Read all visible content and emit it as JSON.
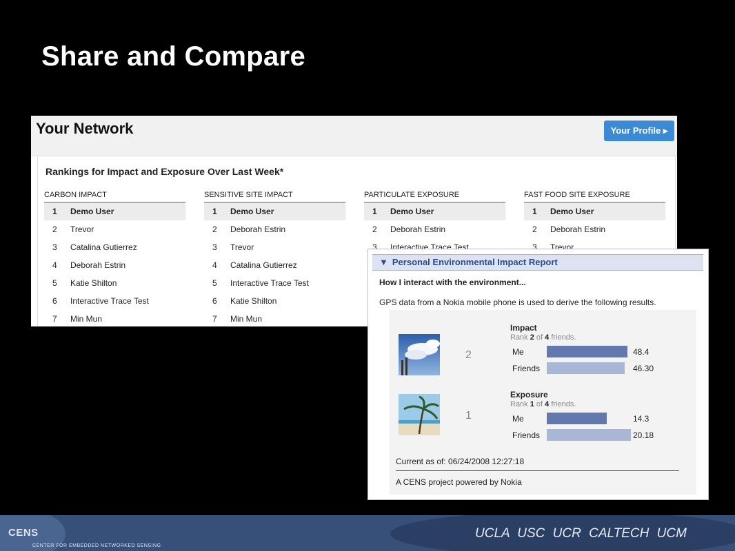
{
  "slide": {
    "title": "Share and Compare"
  },
  "network": {
    "title": "Your Network",
    "profile_button": "Your Profile",
    "rankings_title": "Rankings for Impact and Exposure Over Last Week*",
    "columns": [
      {
        "header": "CARBON IMPACT",
        "rows": [
          {
            "rank": "1",
            "name": "Demo User"
          },
          {
            "rank": "2",
            "name": "Trevor"
          },
          {
            "rank": "3",
            "name": "Catalina Gutierrez"
          },
          {
            "rank": "4",
            "name": "Deborah Estrin"
          },
          {
            "rank": "5",
            "name": "Katie Shilton"
          },
          {
            "rank": "6",
            "name": "Interactive Trace Test"
          },
          {
            "rank": "7",
            "name": "Min Mun"
          }
        ]
      },
      {
        "header": "SENSITIVE SITE IMPACT",
        "rows": [
          {
            "rank": "1",
            "name": "Demo User"
          },
          {
            "rank": "2",
            "name": "Deborah Estrin"
          },
          {
            "rank": "3",
            "name": "Trevor"
          },
          {
            "rank": "4",
            "name": "Catalina Gutierrez"
          },
          {
            "rank": "5",
            "name": "Interactive Trace Test"
          },
          {
            "rank": "6",
            "name": "Katie Shilton"
          },
          {
            "rank": "7",
            "name": "Min Mun"
          }
        ]
      },
      {
        "header": "PARTICULATE EXPOSURE",
        "rows": [
          {
            "rank": "1",
            "name": "Demo User"
          },
          {
            "rank": "2",
            "name": "Deborah Estrin"
          },
          {
            "rank": "3",
            "name": "Interactive Trace Test"
          }
        ]
      },
      {
        "header": "FAST FOOD SITE EXPOSURE",
        "rows": [
          {
            "rank": "1",
            "name": "Demo User"
          },
          {
            "rank": "2",
            "name": "Deborah Estrin"
          },
          {
            "rank": "3",
            "name": "Trevor"
          }
        ]
      }
    ]
  },
  "report": {
    "title": "Personal Environmental Impact Report",
    "subtitle": "How I interact with the environment...",
    "gps_note": "GPS data from a Nokia mobile phone is used to derive the following results.",
    "impact": {
      "title": "Impact",
      "rank_prefix": "Rank ",
      "rank": "2",
      "rank_mid": " of ",
      "total": "4",
      "rank_suffix": " friends.",
      "big_rank": "2",
      "me_label": "Me",
      "me_value": "48.4",
      "friends_label": "Friends",
      "friends_value": "46.30",
      "me_fraction": 0.96,
      "friends_fraction": 0.93
    },
    "exposure": {
      "title": "Exposure",
      "rank_prefix": "Rank ",
      "rank": "1",
      "rank_mid": " of ",
      "total": "4",
      "rank_suffix": " friends.",
      "big_rank": "1",
      "me_label": "Me",
      "me_value": "14.3",
      "friends_label": "Friends",
      "friends_value": "20.18",
      "me_fraction": 0.71,
      "friends_fraction": 1.0
    },
    "current_as_of": "Current as of: 06/24/2008 12:27:18",
    "powered_by": "A CENS project powered by Nokia"
  },
  "footer": {
    "logo_text": "CENS",
    "logo_subtitle": "CENTER FOR EMBEDDED NETWORKED SENSING",
    "universities": "UCLA USC UCR CALTECH UCM"
  }
}
